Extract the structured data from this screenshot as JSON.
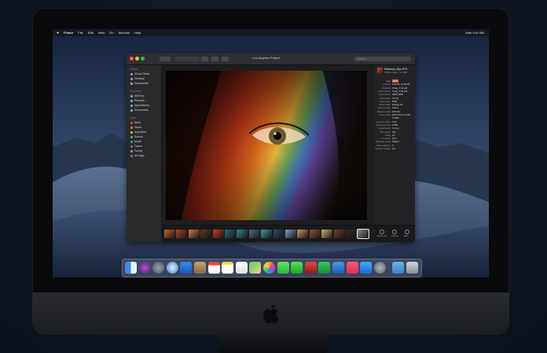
{
  "menubar": {
    "apple": "",
    "app_name": "Finder",
    "items": [
      "File",
      "Edit",
      "View",
      "Go",
      "Window",
      "Help"
    ],
    "clock": "Mon 9:41 AM"
  },
  "window": {
    "title": "Los Angeles Project",
    "search_placeholder": "Search"
  },
  "sidebar": {
    "favorites_header": "iCloud",
    "locations_header": "Favorites",
    "tags_header": "Tags",
    "icloud_items": [
      "iCloud Drive",
      "Desktop",
      "Documents"
    ],
    "favorite_items": [
      "AirDrop",
      "Recents",
      "Applications",
      "Downloads"
    ],
    "tags": [
      {
        "label": "Work",
        "color": "#e74c3c"
      },
      {
        "label": "Home",
        "color": "#e67e22"
      },
      {
        "label": "Important",
        "color": "#f1c40f"
      },
      {
        "label": "School",
        "color": "#2ecc71"
      },
      {
        "label": "Music",
        "color": "#3498db"
      },
      {
        "label": "Travel",
        "color": "#9b59b6"
      },
      {
        "label": "Family",
        "color": "#95a5a6"
      },
      {
        "label": "All Tags…",
        "color": ""
      }
    ]
  },
  "inspector": {
    "filename": "Rainbow_Eye.JPG",
    "subtitle": "JPEG image - 3.4 MB",
    "rows": [
      {
        "k": "Tags",
        "v": "Work"
      },
      {
        "k": "Created",
        "v": "6/12/18, 11:48 AM"
      },
      {
        "k": "Modified",
        "v": "Today, 9:41 AM"
      },
      {
        "k": "Last opened",
        "v": "Today, 9:41 AM"
      },
      {
        "k": "Dimensions",
        "v": "4928×3264"
      },
      {
        "k": "Resolution",
        "v": "72×72"
      },
      {
        "k": "Color space",
        "v": "RGB"
      },
      {
        "k": "Color profile",
        "v": "Display P3"
      },
      {
        "k": "Device make",
        "v": "Canon"
      },
      {
        "k": "Device model",
        "v": "EOS 5D"
      },
      {
        "k": "Lens model",
        "v": "EF24-70mm f/2.8L"
      },
      {
        "k": "",
        "v": "II USM"
      },
      {
        "k": "Aperture value",
        "v": "4.97"
      },
      {
        "k": "Exposure time",
        "v": "1/250"
      },
      {
        "k": "Focal length",
        "v": "70 mm"
      },
      {
        "k": "ISO speed",
        "v": "400"
      },
      {
        "k": "Flash",
        "v": "No"
      },
      {
        "k": "F number",
        "v": "f/5.6"
      },
      {
        "k": "Metering mode",
        "v": "Pattern"
      },
      {
        "k": "White balance",
        "v": "0"
      },
      {
        "k": "Content Creator",
        "v": "Pro"
      }
    ]
  },
  "quick_actions": [
    "Rotate Left",
    "Markup",
    "More…"
  ],
  "colors": {
    "accent": "#3478f6",
    "window_bg": "#1e1e20",
    "sidebar_bg": "#2a2a2d"
  }
}
